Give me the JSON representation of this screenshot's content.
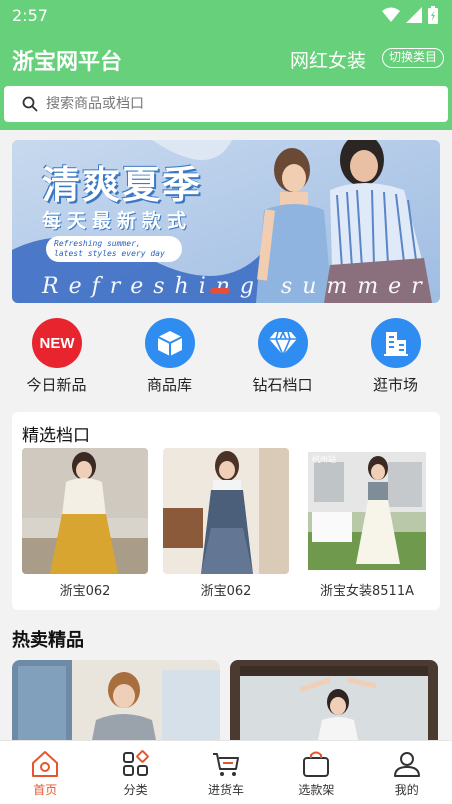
{
  "status_bar": {
    "time": "2:57",
    "icons": [
      "wifi-icon",
      "signal-icon",
      "battery-icon"
    ]
  },
  "header": {
    "title": "浙宝网平台",
    "category": "网红女装",
    "switch_label": "切换类目"
  },
  "search": {
    "placeholder": "搜索商品或档口"
  },
  "banner": {
    "title": "清爽夏季",
    "subtitle": "每天最新款式",
    "tagline_line1": "Refreshing summer,",
    "tagline_line2": "latest styles every day",
    "script_text": "Refreshing summer"
  },
  "quick_menu": [
    {
      "label": "今日新品",
      "icon": "new-badge-icon",
      "color": "#e8242f"
    },
    {
      "label": "商品库",
      "icon": "box-icon",
      "color": "#2f8cf0"
    },
    {
      "label": "钻石档口",
      "icon": "diamond-icon",
      "color": "#2f8cf0"
    },
    {
      "label": "逛市场",
      "icon": "building-icon",
      "color": "#2f8cf0"
    }
  ],
  "featured_stalls": {
    "title": "精选档口",
    "items": [
      {
        "name": "浙宝062"
      },
      {
        "name": "浙宝062"
      },
      {
        "name": "浙宝女装8511A",
        "photo_tag": "杭州站"
      }
    ]
  },
  "hot_picks": {
    "title": "热卖精品"
  },
  "tab_bar": {
    "active": "home",
    "items": [
      {
        "label": "首页",
        "icon": "home-icon"
      },
      {
        "label": "分类",
        "icon": "category-icon"
      },
      {
        "label": "进货车",
        "icon": "cart-icon"
      },
      {
        "label": "选款架",
        "icon": "bag-icon"
      },
      {
        "label": "我的",
        "icon": "user-icon"
      }
    ]
  },
  "colors": {
    "brand_green": "#66d17a",
    "accent": "#e6562e",
    "icon_blue": "#2f8cf0"
  }
}
